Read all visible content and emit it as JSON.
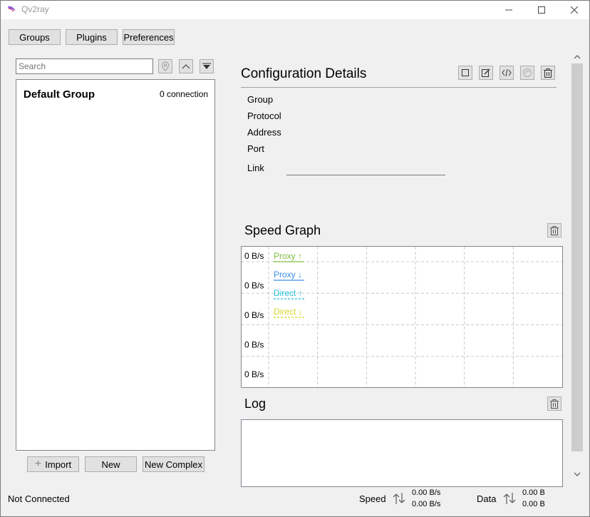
{
  "window": {
    "title": "Qv2ray"
  },
  "toolbar": {
    "groups": "Groups",
    "plugins": "Plugins",
    "preferences": "Preferences"
  },
  "search": {
    "placeholder": "Search"
  },
  "group": {
    "name": "Default Group",
    "count": "0 connection"
  },
  "bottom_buttons": {
    "import": "Import",
    "new": "New",
    "new_complex": "New Complex"
  },
  "details": {
    "title": "Configuration Details",
    "labels": {
      "group": "Group",
      "protocol": "Protocol",
      "address": "Address",
      "port": "Port",
      "link": "Link"
    }
  },
  "speed_graph": {
    "title": "Speed Graph",
    "y_ticks": [
      "0 B/s",
      "0 B/s",
      "0 B/s",
      "0 B/s",
      "0 B/s"
    ],
    "legend": [
      {
        "label": "Proxy ↑",
        "color": "#7cbe3d"
      },
      {
        "label": "Proxy ↓",
        "color": "#3a8ee6"
      },
      {
        "label": "Direct ↑",
        "color": "#1ebfe0"
      },
      {
        "label": "Direct ↓",
        "color": "#d6d62a"
      }
    ]
  },
  "log": {
    "title": "Log"
  },
  "status_bar": {
    "connection": "Not Connected",
    "speed_label": "Speed",
    "speed_up": "0.00 B/s",
    "speed_down": "0.00 B/s",
    "data_label": "Data",
    "data_up": "0.00 B",
    "data_down": "0.00 B"
  }
}
